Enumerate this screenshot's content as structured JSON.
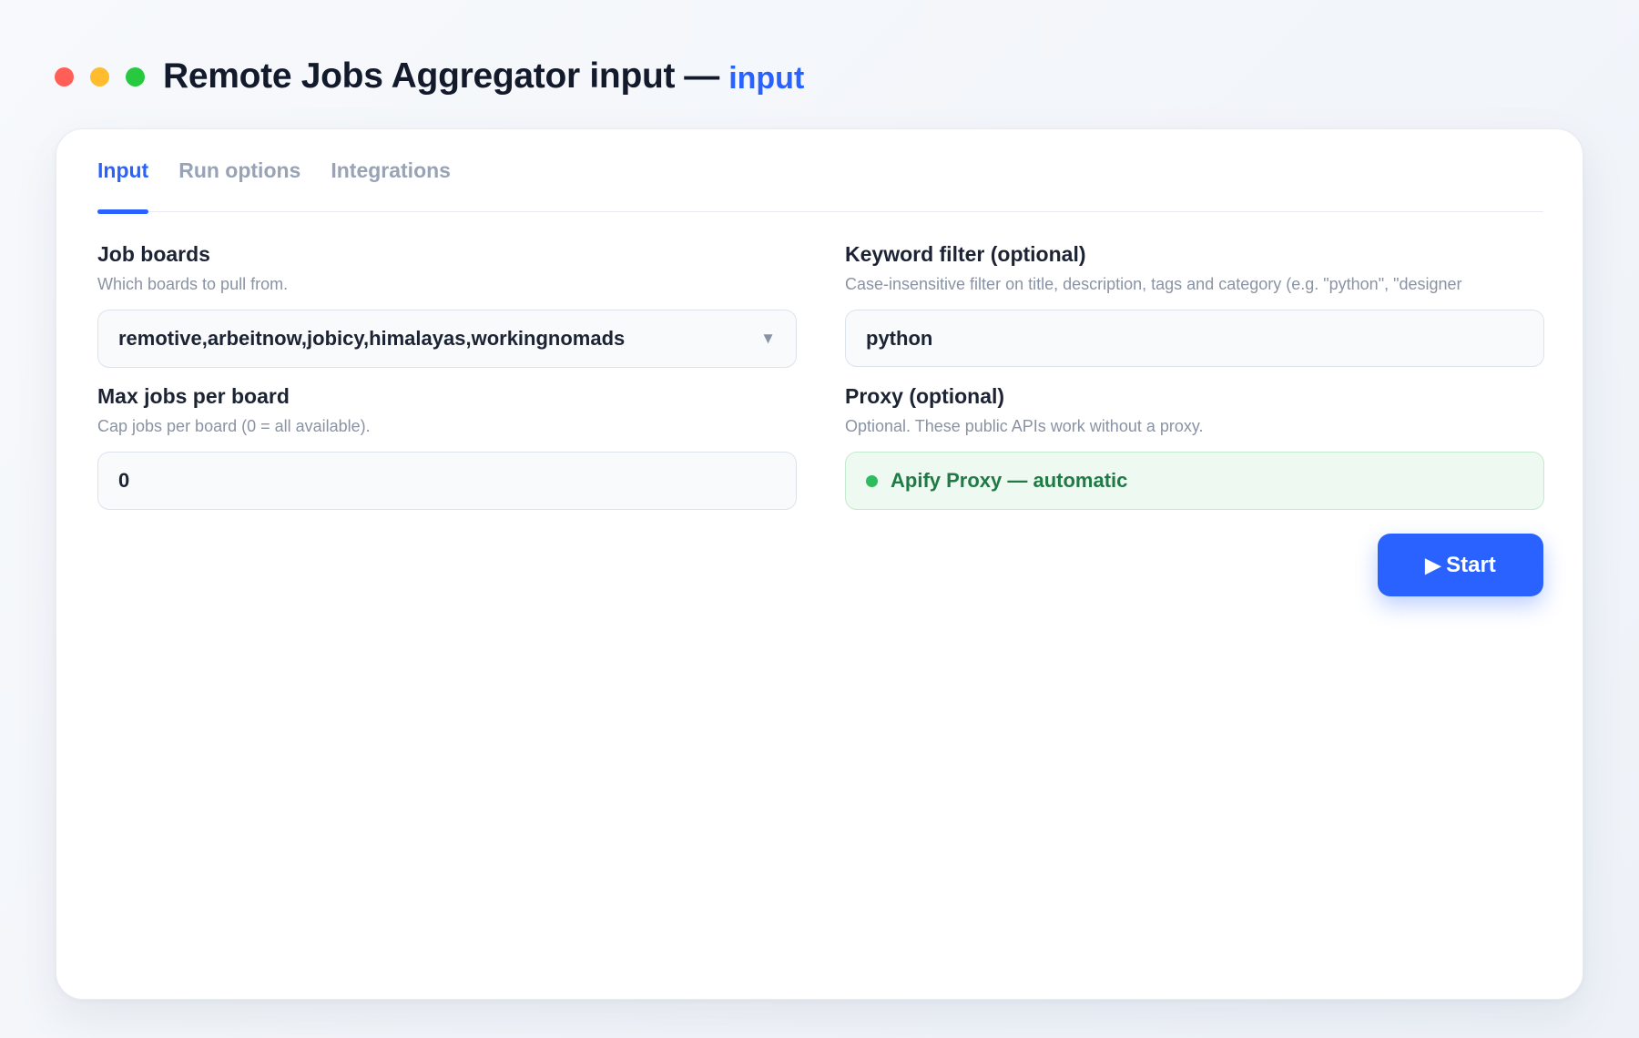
{
  "colors": {
    "accent": "#2962ff",
    "traffic_red": "#ff5f57",
    "traffic_yellow": "#febc2e",
    "traffic_green": "#28c840",
    "proxy_green": "#2ebd5c"
  },
  "window": {
    "title": "Remote Jobs Aggregator input",
    "separator": "—",
    "subtitle": "input"
  },
  "tabs": [
    {
      "label": "Input",
      "active": true
    },
    {
      "label": "Run options",
      "active": false
    },
    {
      "label": "Integrations",
      "active": false
    }
  ],
  "fields": {
    "job_boards": {
      "label": "Job boards",
      "help": "Which boards to pull from.",
      "value": "remotive,arbeitnow,jobicy,himalayas,workingnomads",
      "icon": "chevron-down-icon"
    },
    "keyword": {
      "label": "Keyword filter (optional)",
      "help": "Case-insensitive filter on title, description, tags and category (e.g. \"python\", \"designer",
      "value": "python"
    },
    "max_jobs": {
      "label": "Max jobs per board",
      "help": "Cap jobs per board (0 = all available).",
      "value": "0"
    },
    "proxy": {
      "label": "Proxy (optional)",
      "help": "Optional. These public APIs work without a proxy.",
      "value": "Apify Proxy — automatic",
      "icon": "status-dot-icon"
    }
  },
  "actions": {
    "start_icon": "▶",
    "start_label": "Start"
  }
}
